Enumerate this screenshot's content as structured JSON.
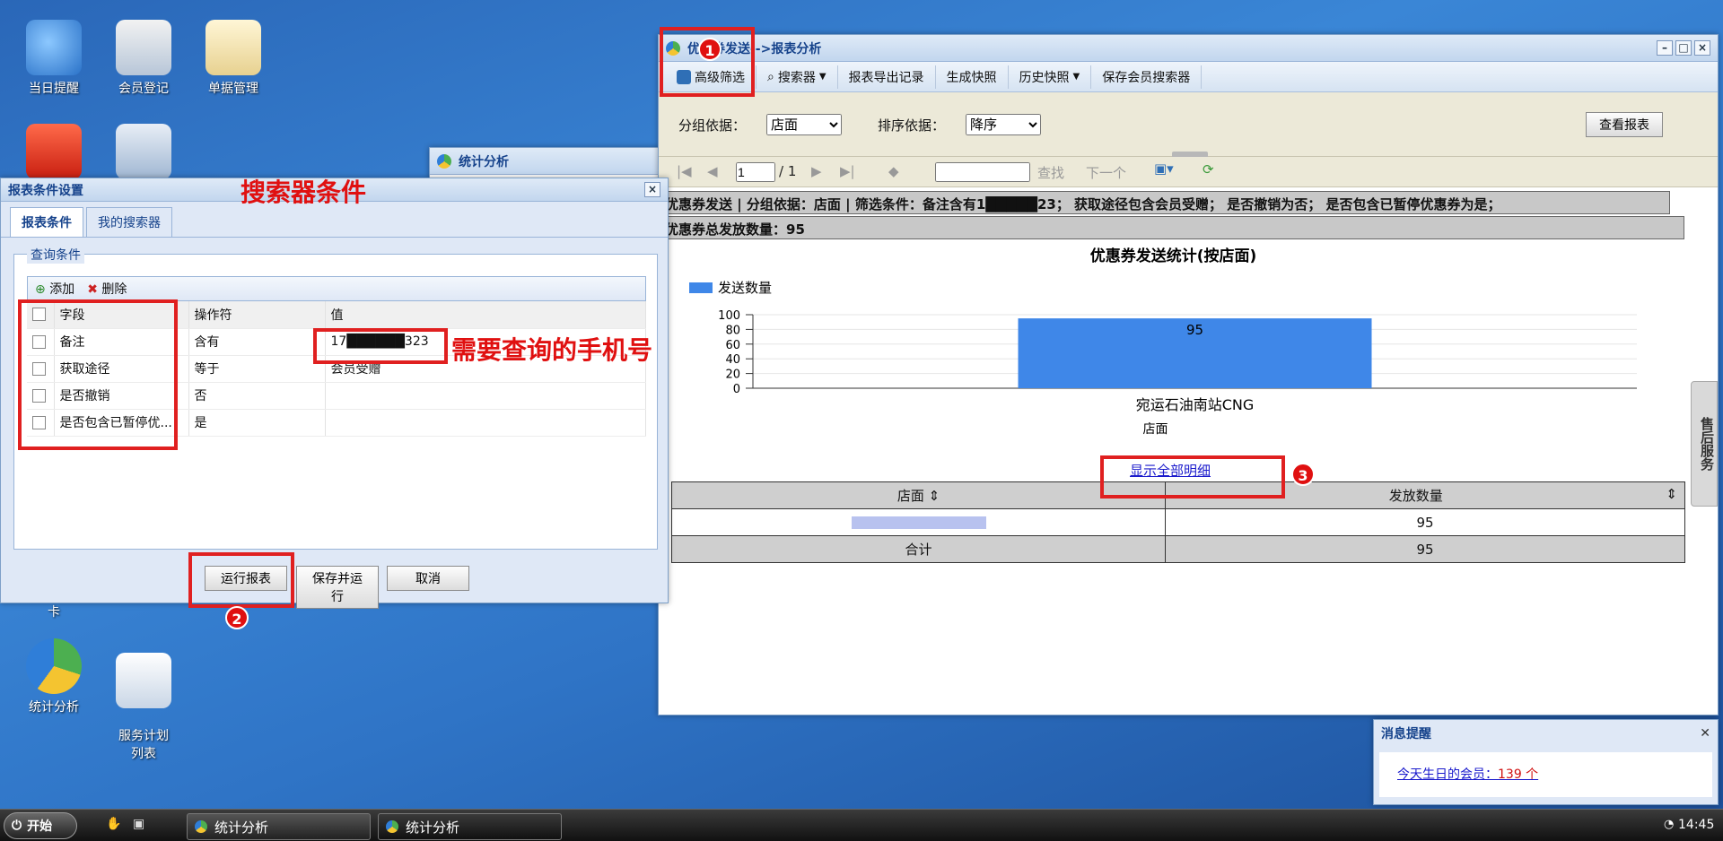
{
  "desktop": {
    "icons": [
      {
        "label": "当日提醒"
      },
      {
        "label": "会员登记"
      },
      {
        "label": "单据管理"
      },
      {
        "label": "卡"
      },
      {
        "label": "统计分析"
      },
      {
        "label": "服务计划\n列表"
      }
    ]
  },
  "bg_window": {
    "title": "统计分析"
  },
  "report_window": {
    "title": "优惠券发送-->报表分析",
    "toolbar": [
      {
        "label": "高级筛选"
      },
      {
        "label": "搜索器"
      },
      {
        "label": "报表导出记录"
      },
      {
        "label": "生成快照"
      },
      {
        "label": "历史快照"
      },
      {
        "label": "保存会员搜索器"
      }
    ],
    "group_label": "分组依据：",
    "group_value": "店面",
    "sort_label": "排序依据：",
    "sort_value": "降序",
    "view_button": "查看报表",
    "pager": {
      "page": "1",
      "total": "/ 1",
      "find_label": "查找",
      "next_label": "下一个"
    },
    "condition_text": "优惠券发送 | 分组依据：店面 | 筛选条件：备注含有1█████23； 获取途径包含会员受赠； 是否撤销为否； 是否包含已暂停优惠券为是；",
    "total_text": "优惠券总发放数量：95",
    "show_all_link": "显示全部明细",
    "table": {
      "headers": [
        "店面",
        "发放数量"
      ],
      "rows": [
        [
          "",
          "95"
        ]
      ],
      "total_row": [
        "合计",
        "95"
      ]
    }
  },
  "chart_data": {
    "type": "bar",
    "title": "优惠券发送统计(按店面)",
    "categories": [
      "宛运石油南站CNG"
    ],
    "series": [
      {
        "name": "发送数量",
        "values": [
          95
        ]
      }
    ],
    "xlabel": "店面",
    "ylabel": "",
    "ylim": [
      0,
      100
    ],
    "yticks": [
      0,
      20,
      40,
      60,
      80,
      100
    ],
    "data_labels": [
      "95"
    ],
    "color": "#3f87e8",
    "grid": true,
    "legend": "top-left"
  },
  "search_dialog": {
    "title": "报表条件设置",
    "tabs": [
      {
        "label": "报表条件"
      },
      {
        "label": "我的搜索器"
      }
    ],
    "fieldset_label": "查询条件",
    "add_label": "添加",
    "delete_label": "删除",
    "headers": [
      "字段",
      "操作符",
      "值"
    ],
    "rows": [
      [
        "备注",
        "含有",
        "17██████323"
      ],
      [
        "获取途径",
        "等于",
        "会员受赠"
      ],
      [
        "是否撤销",
        "否",
        ""
      ],
      [
        "是否包含已暂停优...",
        "是",
        ""
      ]
    ],
    "buttons": [
      {
        "label": "运行报表"
      },
      {
        "label": "保存并运行"
      },
      {
        "label": "取消"
      }
    ]
  },
  "annotations": {
    "search_title": "搜索器条件",
    "phone_note": "需要查询的手机号",
    "badges": [
      "1",
      "2",
      "3"
    ]
  },
  "side_tab": "售后服务",
  "message": {
    "title": "消息提醒",
    "text": "今天生日的会员：",
    "count": "139 个"
  },
  "taskbar": {
    "start": "开始",
    "tasks": [
      {
        "label": "统计分析"
      },
      {
        "label": "统计分析"
      }
    ],
    "clock": "14:45"
  }
}
